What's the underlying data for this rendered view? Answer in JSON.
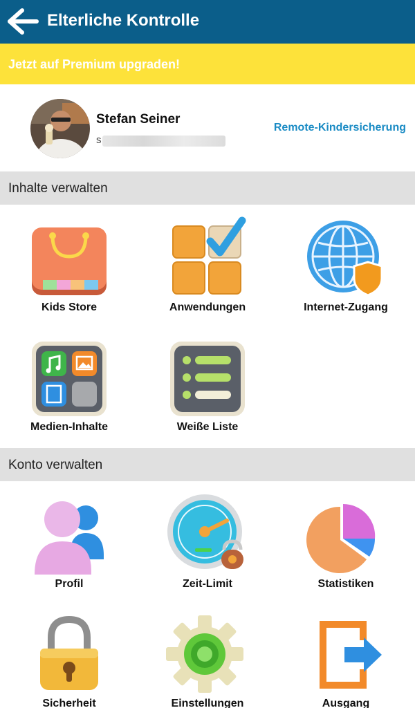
{
  "header": {
    "title": "Elterliche Kontrolle"
  },
  "premium_banner": {
    "text": "Jetzt auf Premium upgraden!"
  },
  "profile": {
    "name": "Stefan Seiner",
    "email_visible": "s",
    "remote_link": "Remote-Kindersicherung"
  },
  "sections": {
    "content": {
      "title": "Inhalte verwalten"
    },
    "account": {
      "title": "Konto verwalten"
    }
  },
  "content_items": [
    {
      "label": "Kids Store",
      "icon": "shopping-bag-icon"
    },
    {
      "label": "Anwendungen",
      "icon": "apps-checklist-icon"
    },
    {
      "label": "Internet-Zugang",
      "icon": "globe-shield-icon"
    },
    {
      "label": "Medien-Inhalte",
      "icon": "media-content-icon"
    },
    {
      "label": "Weiße Liste",
      "icon": "whitelist-icon"
    }
  ],
  "account_items": [
    {
      "label": "Profil",
      "icon": "profile-icon"
    },
    {
      "label": "Zeit-Limit",
      "icon": "time-limit-icon"
    },
    {
      "label": "Statistiken",
      "icon": "statistics-icon"
    },
    {
      "label": "Sicherheit",
      "icon": "padlock-icon"
    },
    {
      "label": "Einstellungen",
      "icon": "settings-gear-icon"
    },
    {
      "label": "Ausgang",
      "icon": "exit-icon"
    }
  ],
  "colors": {
    "appbar": "#0b5e8a",
    "premium": "#fde23a",
    "link": "#1a8bc4",
    "section": "#e0e0e0"
  }
}
